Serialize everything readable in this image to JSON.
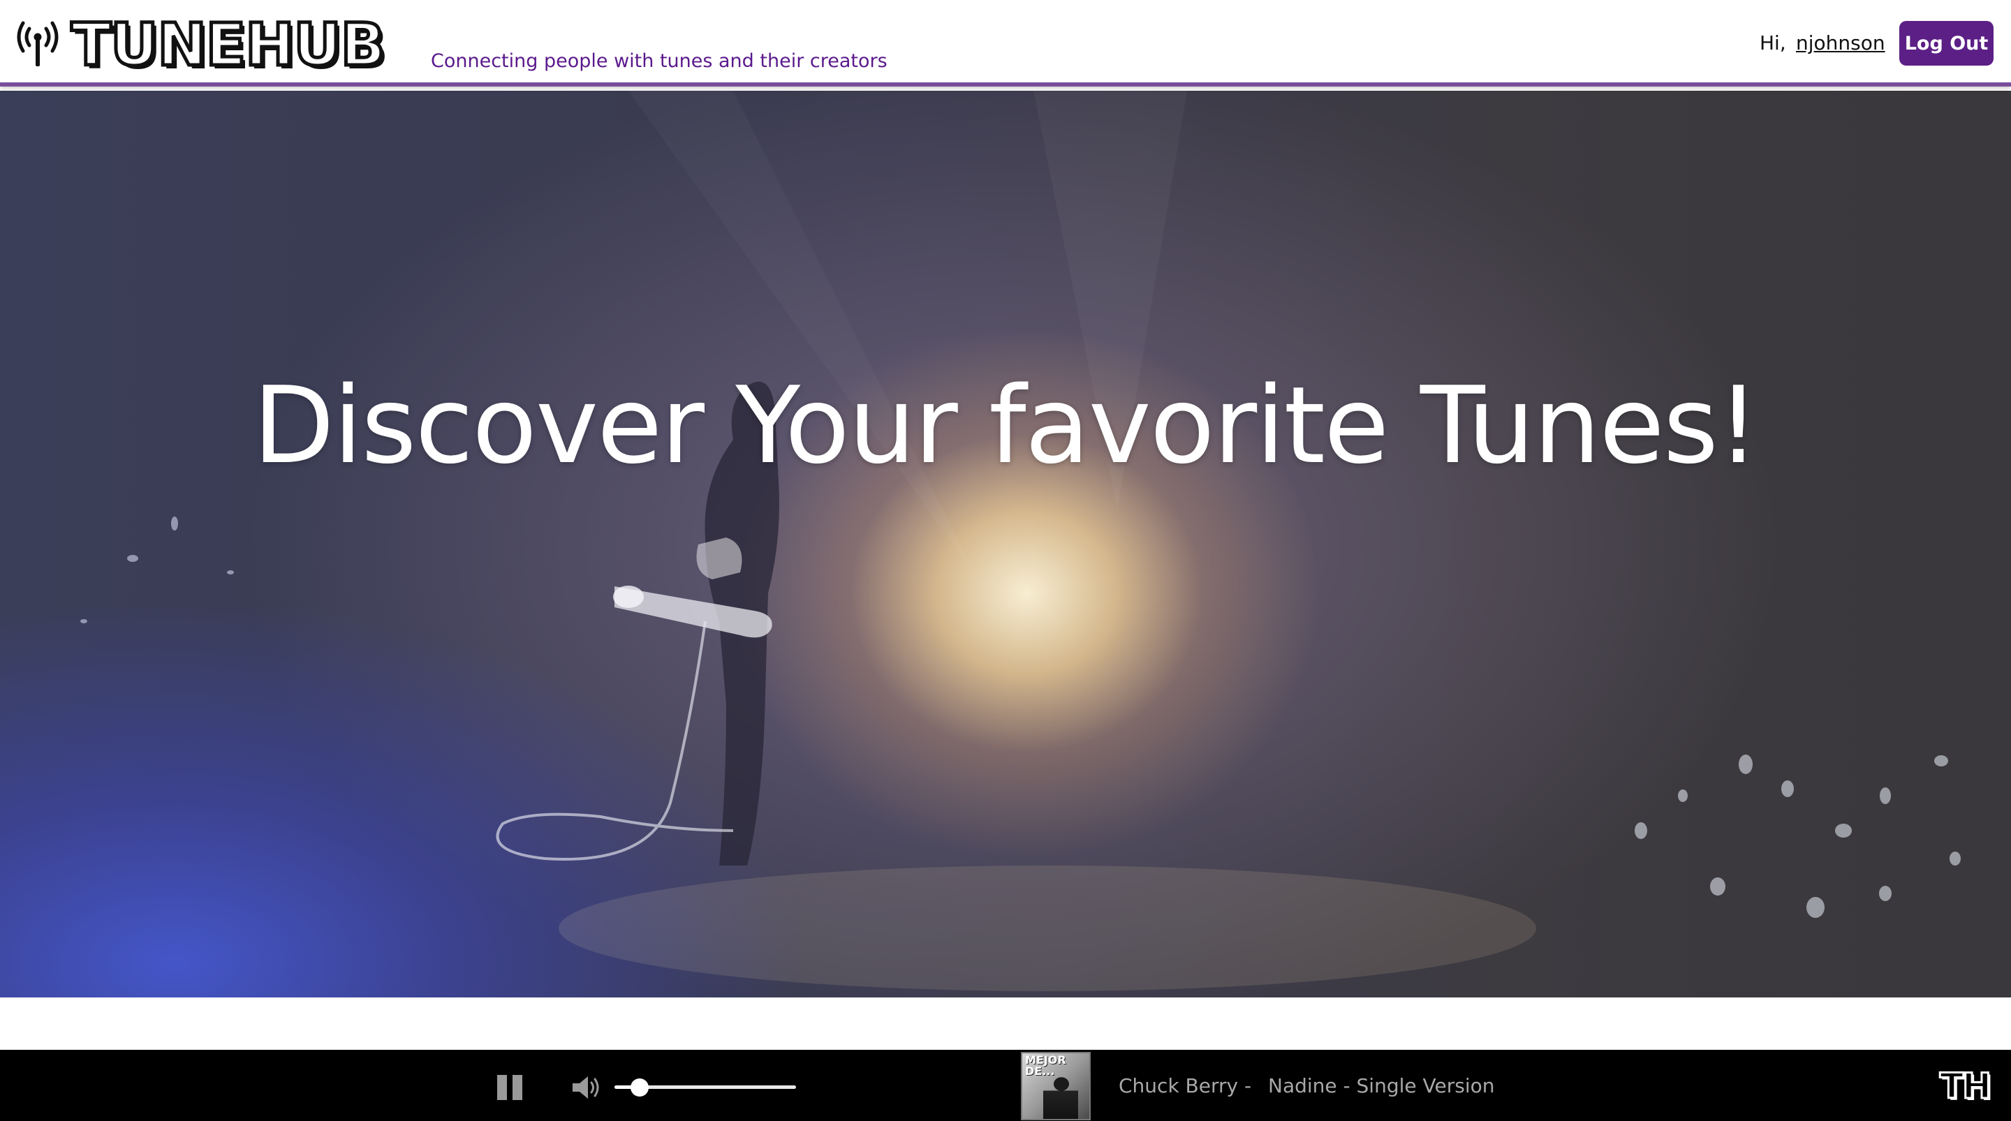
{
  "header": {
    "logo_text": "TUNEHUB",
    "tagline": "Connecting people with tunes and their creators",
    "greeting": "Hi,",
    "username": "njohnson",
    "logout_label": "Log Out",
    "accent_color": "#5b1f86"
  },
  "hero": {
    "title": "Discover Your favorite Tunes!"
  },
  "player": {
    "state": "playing",
    "volume": 0.14,
    "album_art_text": "MEJOR DE...",
    "artist": "Chuck Berry",
    "separator": "-",
    "track": "Nadine - Single Version",
    "brand_mark": "TH",
    "icons": [
      "pause-icon",
      "volume-icon"
    ]
  }
}
